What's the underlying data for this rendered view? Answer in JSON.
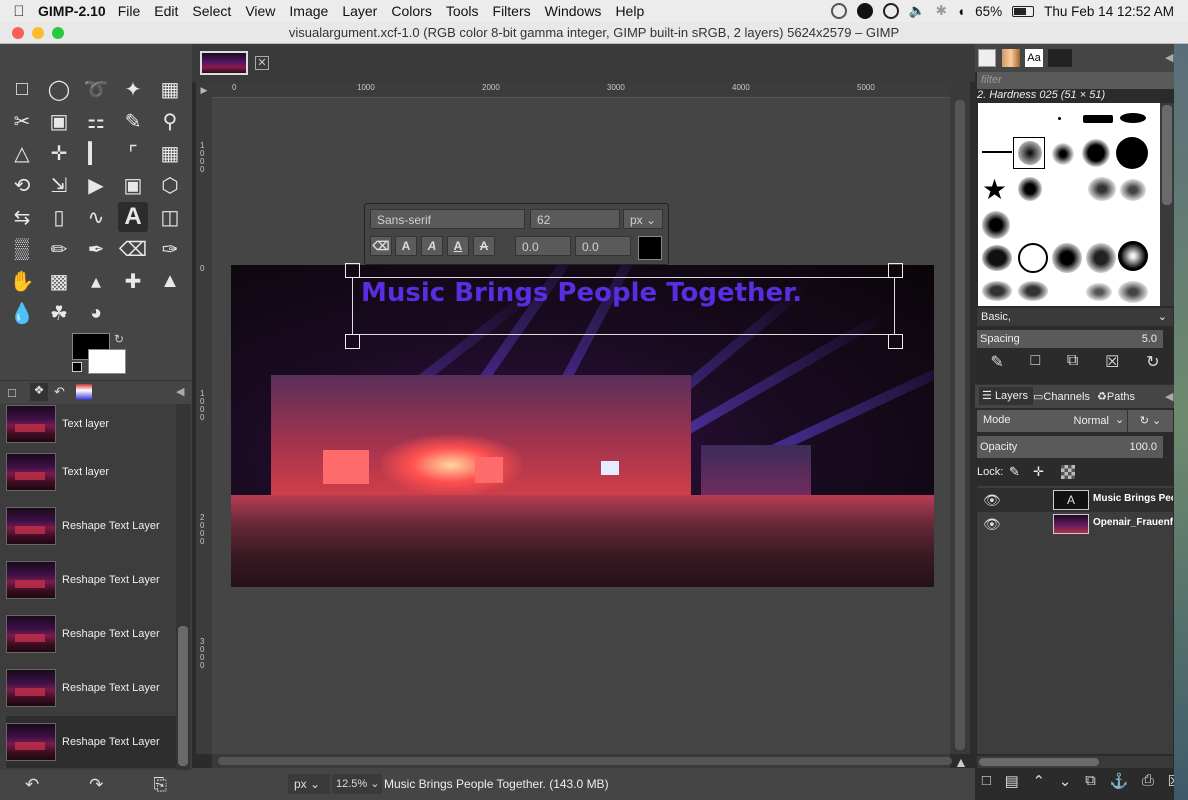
{
  "menubar": {
    "apple": "",
    "app_name": "GIMP-2.10",
    "items": [
      "File",
      "Edit",
      "Select",
      "View",
      "Image",
      "Layer",
      "Colors",
      "Tools",
      "Filters",
      "Windows",
      "Help"
    ],
    "battery": "65%",
    "datetime": "Thu Feb 14  12:52 AM"
  },
  "window": {
    "title": "visualargument.xcf-1.0 (RGB color 8-bit gamma integer, GIMP built-in sRGB, 2 layers) 5624x2579 – GIMP"
  },
  "toolbox": {
    "fg_color": "#000000",
    "bg_color": "#ffffff"
  },
  "history": {
    "items": [
      "Text layer",
      "Text layer",
      "Reshape Text Layer",
      "Reshape Text Layer",
      "Reshape Text Layer",
      "Reshape Text Layer",
      "Reshape Text Layer"
    ]
  },
  "rulers": {
    "h_labels": [
      "0",
      "1000",
      "2000",
      "3000",
      "4000",
      "5000"
    ],
    "v_labels": [
      "1000",
      "0",
      "1000",
      "2000",
      "3000"
    ]
  },
  "text_tool": {
    "font": "Sans-serif",
    "size": "62",
    "unit": "px",
    "baseline": "0.0",
    "kerning": "0.0"
  },
  "canvas": {
    "text": "Music Brings People Together.",
    "text_color": "#5a2de0"
  },
  "statusbar": {
    "unit": "px",
    "zoom": "12.5%",
    "message": "Music Brings People Together. (143.0 MB)"
  },
  "brushes": {
    "filter_placeholder": "filter",
    "current": "2. Hardness 025 (51 × 51)",
    "set": "Basic,",
    "spacing_label": "Spacing",
    "spacing_value": "5.0",
    "tab_text": "Aa"
  },
  "layers": {
    "tabs": [
      "Layers",
      "Channels",
      "Paths"
    ],
    "mode_label": "Mode",
    "mode_value": "Normal",
    "opacity_label": "Opacity",
    "opacity_value": "100.0",
    "lock_label": "Lock:",
    "items": [
      "Music Brings Peop",
      "Openair_Frauenf"
    ]
  }
}
